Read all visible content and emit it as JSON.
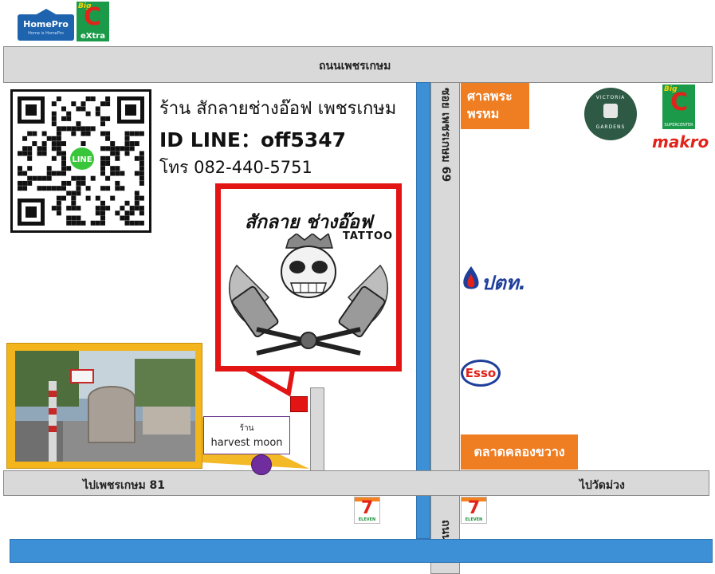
{
  "roads": {
    "top": "ถนนเพชรเกษม",
    "soi_69": "ซอย เพชรเกษม 69",
    "bottom_left": "ไปเพชรเกษม 81",
    "bottom_right": "ไปวัดม่วง",
    "vertical_bottom": "ถนนหลัก"
  },
  "shop": {
    "name": "ร้าน สักลายช่างอ๊อฟ เพชรเกษม",
    "line_id": "ID LINE：off5347",
    "tel": "โทร 082-440-5751"
  },
  "poster": {
    "title": "สักลาย ช่างอ๊อฟ",
    "subtitle": "TATTOO"
  },
  "landmarks": {
    "sala": "ศาลพระพรหม",
    "market": "ตลาดคลองขวาง",
    "harvest_small": "ร้าน",
    "harvest_name": "harvest moon"
  },
  "logos": {
    "homepro": "HomePro",
    "homepro_tag": "Home is HomePro",
    "bigc_big": "Big",
    "bigc_c": "C",
    "bigc_extra": "eXtra",
    "victoria_top": "VICTORIA",
    "victoria_bottom": "GARDENS",
    "makro_bigc_sub": "SUPERCENTER",
    "makro": "makro",
    "ptt": "ปตท.",
    "esso": "Esso",
    "seven": "7",
    "seven_sub": "ELEVEN",
    "line": "LINE"
  },
  "colors": {
    "road": "#d9d9d9",
    "canal": "#3d8fd6",
    "landmark_orange": "#ef7d22",
    "poster_frame": "#e31414",
    "marker_purple": "#6f2d9e"
  }
}
